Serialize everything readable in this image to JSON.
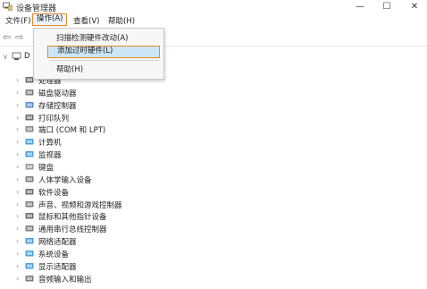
{
  "window": {
    "title": "设备管理器",
    "controls": {
      "minimize": "—",
      "maximize": "☐",
      "close": "✕"
    }
  },
  "menubar": {
    "items": [
      {
        "label": "文件(F)",
        "active": false
      },
      {
        "label": "操作(A)",
        "active": true
      },
      {
        "label": "查看(V)",
        "active": false
      },
      {
        "label": "帮助(H)",
        "active": false
      }
    ]
  },
  "toolbar": {
    "back": "⇦",
    "forward": "⇨"
  },
  "dropdown": {
    "items": [
      {
        "label": "扫描检测硬件改动(A)",
        "highlighted": false
      },
      {
        "label": "添加过时硬件(L)",
        "highlighted": true
      },
      {
        "label": "帮助(H)",
        "highlighted": false
      }
    ]
  },
  "tree": {
    "root": {
      "label": "D",
      "expander": "∨"
    },
    "items": [
      {
        "label": "处理器",
        "icon": "processor-icon",
        "color": "#555555"
      },
      {
        "label": "磁盘驱动器",
        "icon": "disk-drive-icon",
        "color": "#666666"
      },
      {
        "label": "存储控制器",
        "icon": "storage-controller-icon",
        "color": "#3a7bc8"
      },
      {
        "label": "打印队列",
        "icon": "printer-icon",
        "color": "#555555"
      },
      {
        "label": "端口 (COM 和 LPT)",
        "icon": "port-icon",
        "color": "#777777"
      },
      {
        "label": "计算机",
        "icon": "computer-icon",
        "color": "#2d8fd5"
      },
      {
        "label": "监视器",
        "icon": "monitor-icon",
        "color": "#2d8fd5"
      },
      {
        "label": "键盘",
        "icon": "keyboard-icon",
        "color": "#888888"
      },
      {
        "label": "人体学输入设备",
        "icon": "hid-icon",
        "color": "#666666"
      },
      {
        "label": "软件设备",
        "icon": "software-device-icon",
        "color": "#555555"
      },
      {
        "label": "声音、视频和游戏控制器",
        "icon": "sound-icon",
        "color": "#666666"
      },
      {
        "label": "鼠标和其他指针设备",
        "icon": "mouse-icon",
        "color": "#555555"
      },
      {
        "label": "通用串行总线控制器",
        "icon": "usb-icon",
        "color": "#666666"
      },
      {
        "label": "网络适配器",
        "icon": "network-adapter-icon",
        "color": "#2d8fd5"
      },
      {
        "label": "系统设备",
        "icon": "system-device-icon",
        "color": "#2d8fd5"
      },
      {
        "label": "显示适配器",
        "icon": "display-adapter-icon",
        "color": "#2d8fd5"
      },
      {
        "label": "音频输入和输出",
        "icon": "audio-io-icon",
        "color": "#666666"
      }
    ]
  },
  "accent": "#e48a2a",
  "highlight": "#cde6f7"
}
